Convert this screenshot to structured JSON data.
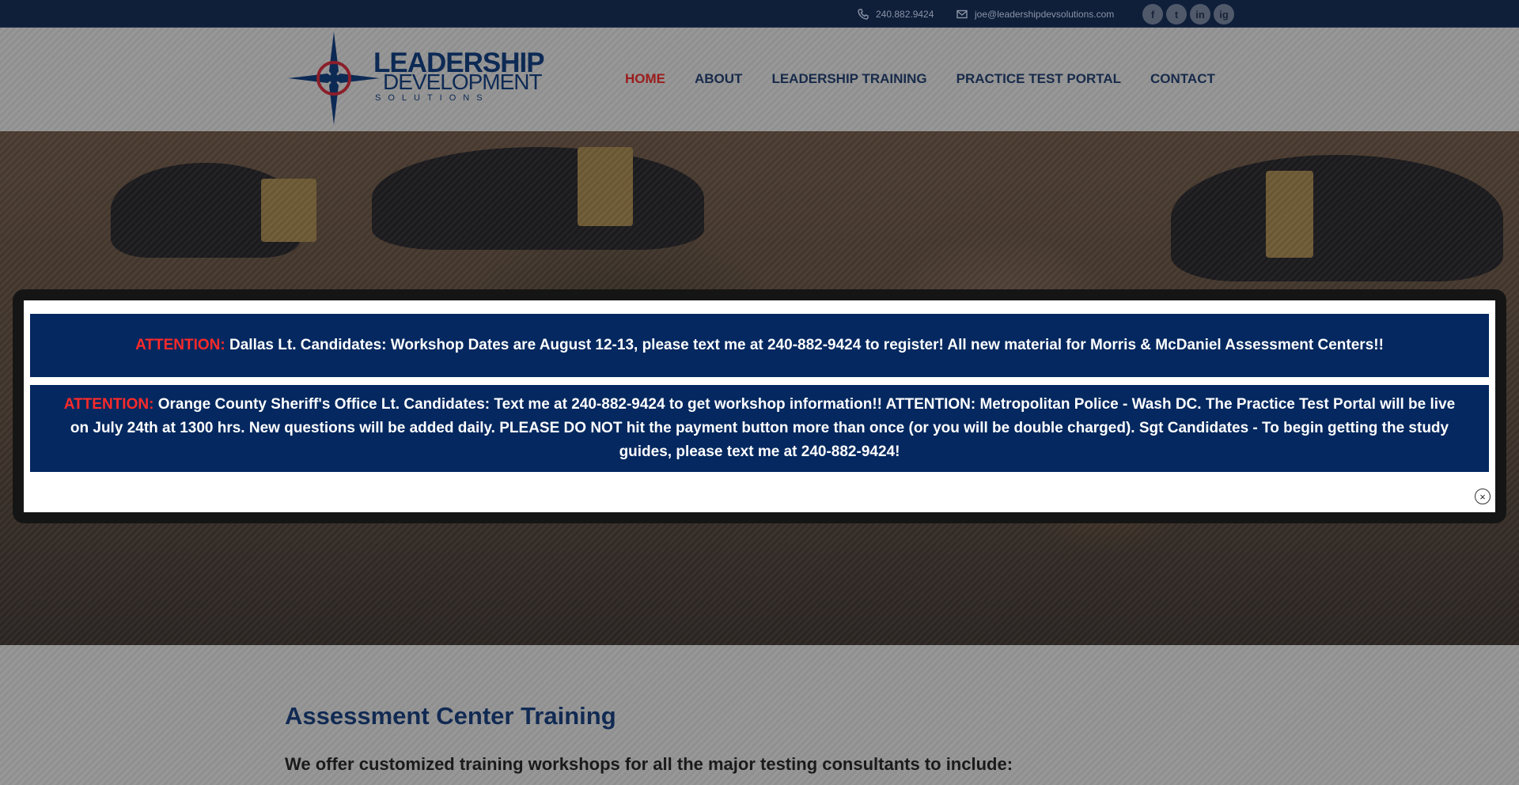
{
  "topbar": {
    "phone": "240.882.9424",
    "email": "joe@leadershipdevsolutions.com",
    "social": [
      "f",
      "t",
      "in",
      "ig"
    ]
  },
  "logo": {
    "line1": "LEADERSHIP",
    "line2": "DEVELOPMENT",
    "line3": "SOLUTIONS"
  },
  "nav": {
    "items": [
      "HOME",
      "ABOUT",
      "LEADERSHIP TRAINING",
      "PRACTICE TEST PORTAL",
      "CONTACT"
    ],
    "active": "HOME"
  },
  "content": {
    "heading": "Assessment Center Training",
    "subheading": "We offer customized training workshops for all the major testing consultants to include:"
  },
  "popup": {
    "notice1": {
      "label": "ATTENTION:",
      "text": " Dallas Lt. Candidates: Workshop Dates are August 12-13, please text me at 240-882-9424 to register! All new material for Morris & McDaniel Assessment Centers!!"
    },
    "notice2": {
      "label": "ATTENTION:",
      "text": " Orange County Sheriff's Office Lt. Candidates: Text me at 240-882-9424 to get workshop information!! ATTENTION: Metropolitan Police - Wash DC. The Practice Test Portal will be live on July 24th at 1300 hrs. New questions will be added daily. PLEASE DO NOT hit the payment button more than once (or you will be double charged). Sgt Candidates - To begin getting the study guides, please text me at 240-882-9424!"
    },
    "close": "×"
  }
}
